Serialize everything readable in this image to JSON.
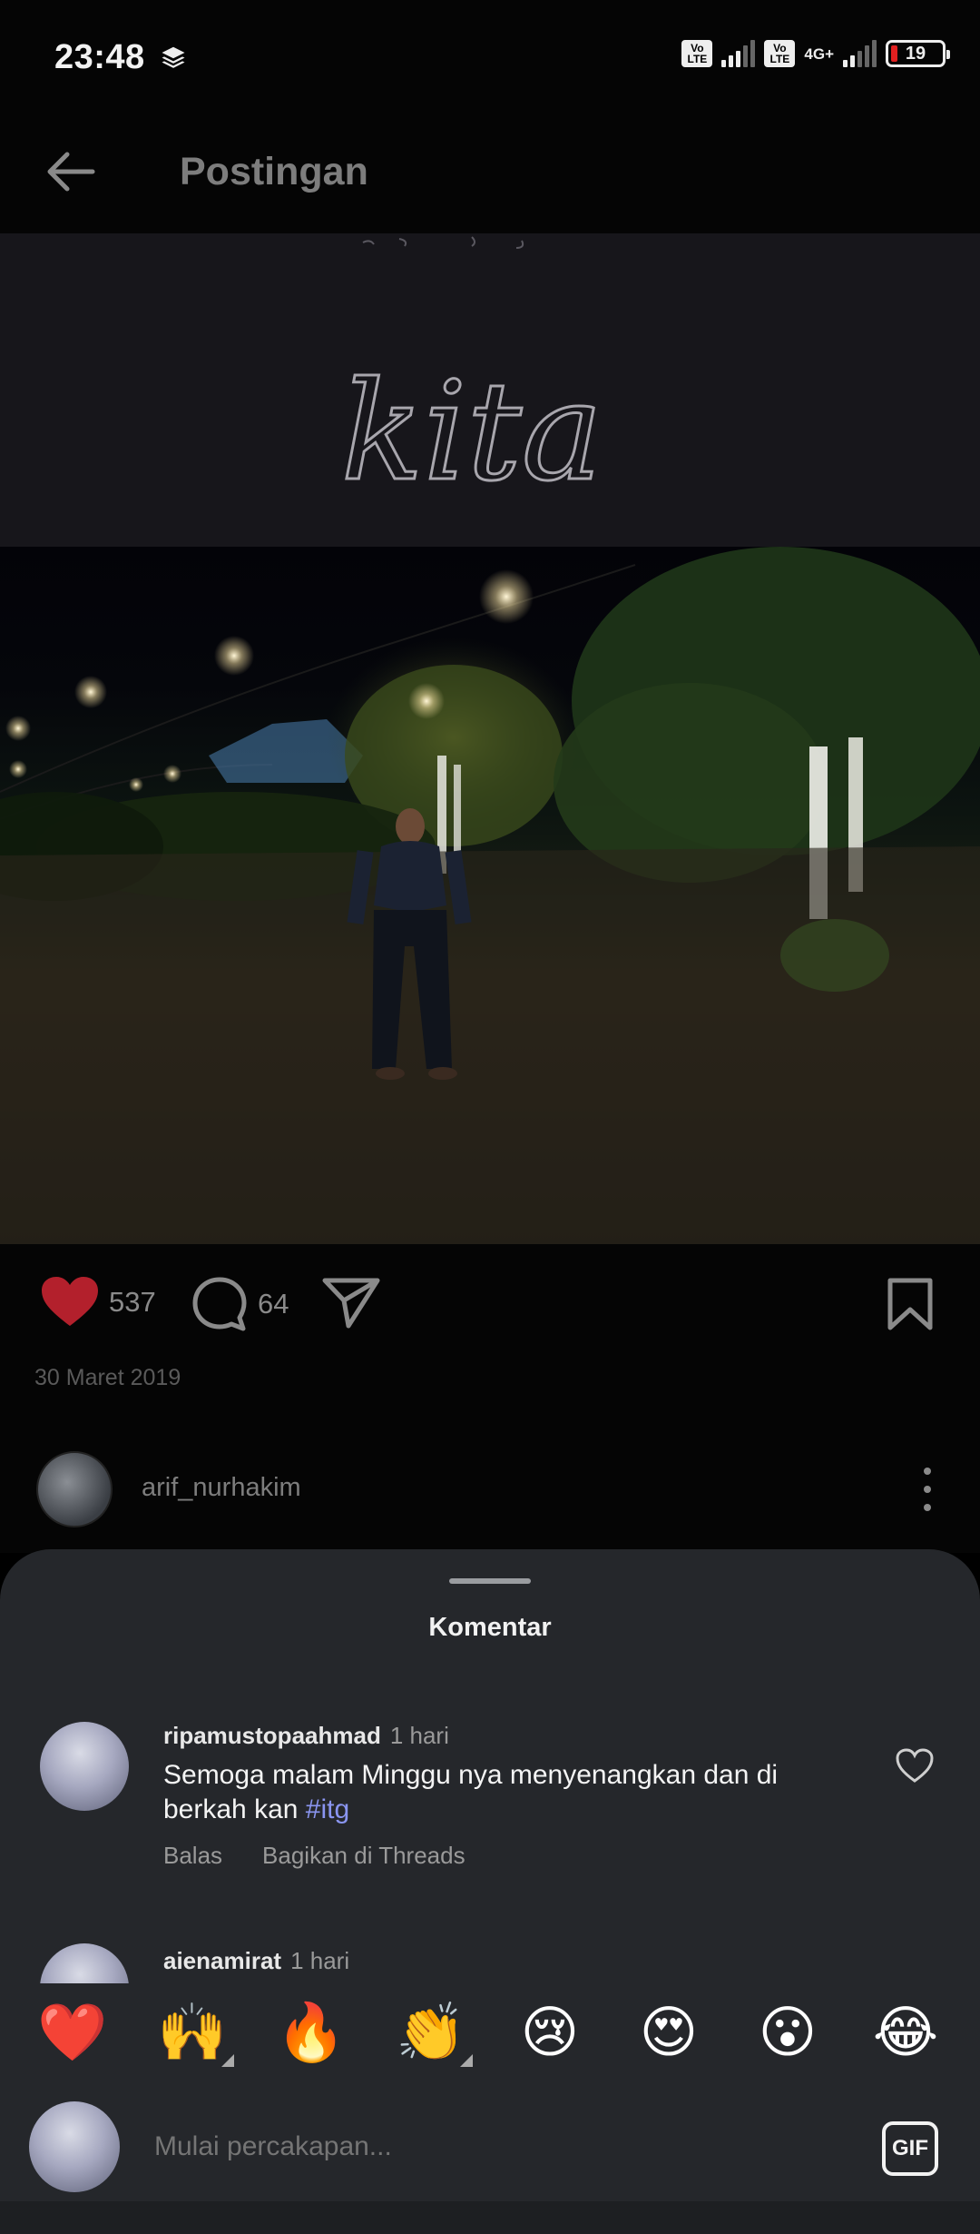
{
  "status_bar": {
    "time": "23:48",
    "network": "4G+",
    "volte_label": "Vo LTE",
    "battery_level": "19",
    "battery_color": "#e02020"
  },
  "header": {
    "title": "Postingan",
    "back_icon": "arrow-left-icon"
  },
  "post": {
    "overlay_text": "kita",
    "likes": "537",
    "comments": "64",
    "liked": true,
    "like_color": "#b3202c",
    "date": "30 Maret 2019",
    "author": "arif_nurhakim"
  },
  "comments_sheet": {
    "title": "Komentar",
    "comments": [
      {
        "user": "ripamustopaahmad",
        "time": "1 hari",
        "text": "Semoga malam Minggu nya menyenangkan dan di berkah kan",
        "hashtag": "#itg",
        "reply_label": "Balas",
        "share_label": "Bagikan di Threads"
      },
      {
        "user": "aienamirat",
        "time": "1 hari"
      }
    ],
    "emoji_reactions": [
      "❤️",
      "🙌",
      "🔥",
      "👏",
      "😢",
      "😍",
      "😮",
      "😂"
    ],
    "input_placeholder": "Mulai percakapan...",
    "gif_label": "GIF"
  }
}
